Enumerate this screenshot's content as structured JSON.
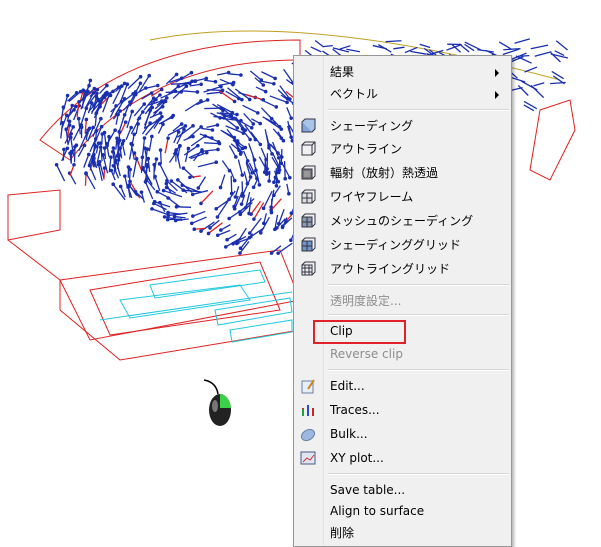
{
  "context_menu": {
    "items": [
      {
        "label": "結果",
        "submenu": true,
        "icon": null
      },
      {
        "label": "ベクトル",
        "submenu": true,
        "icon": null
      },
      {
        "label": "シェーディング",
        "icon": "shaded-cube-icon"
      },
      {
        "label": "アウトライン",
        "icon": "outline-cube-icon"
      },
      {
        "label": "輻射（放射）熱透過",
        "icon": "radiation-cube-icon"
      },
      {
        "label": "ワイヤフレーム",
        "icon": "wireframe-cube-icon"
      },
      {
        "label": "メッシュのシェーディング",
        "icon": "mesh-shading-cube-icon"
      },
      {
        "label": "シェーディンググリッド",
        "icon": "shading-grid-cube-icon"
      },
      {
        "label": "アウトライングリッド",
        "icon": "outline-grid-cube-icon"
      },
      {
        "label": "透明度設定...",
        "disabled": true
      },
      {
        "label": "Clip",
        "highlighted": true
      },
      {
        "label": "Reverse clip",
        "disabled": true
      },
      {
        "label": "Edit...",
        "icon": "edit-pencil-icon"
      },
      {
        "label": "Traces...",
        "icon": "traces-arrows-icon"
      },
      {
        "label": "Bulk...",
        "icon": "bulk-icon"
      },
      {
        "label": "XY plot...",
        "icon": "xy-plot-icon"
      },
      {
        "label": "Save table..."
      },
      {
        "label": "Align to surface"
      },
      {
        "label": "削除"
      }
    ]
  },
  "colors": {
    "highlight_box": "#e0202a",
    "vectors": "#1a2fb0",
    "wire_red": "#e02020",
    "wire_cyan": "#20c8e0"
  }
}
